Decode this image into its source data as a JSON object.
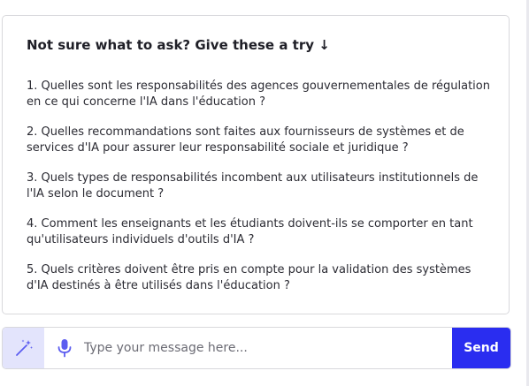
{
  "suggestions": {
    "heading": "Not sure what to ask? Give these a try ↓",
    "questions": [
      "1. Quelles sont les responsabilités des agences gouvernementales de régulation en ce qui concerne l'IA dans l'éducation ?",
      "2. Quelles recommandations sont faites aux fournisseurs de systèmes et de services d'IA pour assurer leur responsabilité sociale et juridique ?",
      "3. Quels types de responsabilités incombent aux utilisateurs institutionnels de l'IA selon le document ?",
      "4. Comment les enseignants et les étudiants doivent-ils se comporter en tant qu'utilisateurs individuels d'outils d'IA ?",
      "5. Quels critères doivent être pris en compte pour la validation des systèmes d'IA destinés à être utilisés dans l'éducation ?"
    ]
  },
  "chat_input": {
    "placeholder": "Type your message here...",
    "value": "",
    "send_label": "Send",
    "magic_icon": "magic-wand-icon",
    "mic_icon": "microphone-icon"
  },
  "colors": {
    "accent": "#2a2df0",
    "accent_light": "#e3e4fc",
    "mic": "#5b5cf0",
    "border": "#d8d8dc",
    "text": "#2b2b33"
  }
}
